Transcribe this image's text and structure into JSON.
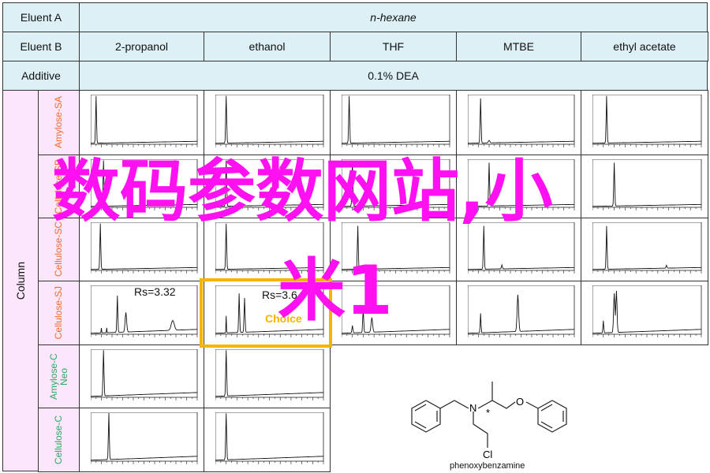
{
  "header": {
    "eluent_a_label": "Eluent A",
    "eluent_a_value": "n-hexane",
    "eluent_b_label": "Eluent B",
    "eluent_b_values": [
      "2-propanol",
      "ethanol",
      "THF",
      "MTBE",
      "ethyl acetate"
    ],
    "additive_label": "Additive",
    "additive_value": "0.1% DEA"
  },
  "column_label": "Column",
  "columns": [
    {
      "name": "Amylose-SA",
      "color": "#f26a2e"
    },
    {
      "name": "Cellulose-SB",
      "color": "#f26a2e"
    },
    {
      "name": "Cellulose-SC",
      "color": "#f26a2e"
    },
    {
      "name": "Cellulose-SJ",
      "color": "#f26a2e"
    },
    {
      "name": "Amylose-C Neo",
      "color": "#2aa860"
    },
    {
      "name": "Cellulose-C",
      "color": "#2aa860"
    }
  ],
  "annotations": {
    "rs_1": "Rs=3.32",
    "rs_2": "Rs=3.6",
    "choice": "Choice",
    "choice_color": "#f5b400"
  },
  "molecule": {
    "name": "phenoxybenzamine",
    "atoms": {
      "n": "N",
      "o": "O",
      "cl": "Cl",
      "stereo": "*"
    }
  },
  "watermark": {
    "line1": "数码参数网站,小",
    "line2": "米1",
    "color": "#ff10f0"
  }
}
